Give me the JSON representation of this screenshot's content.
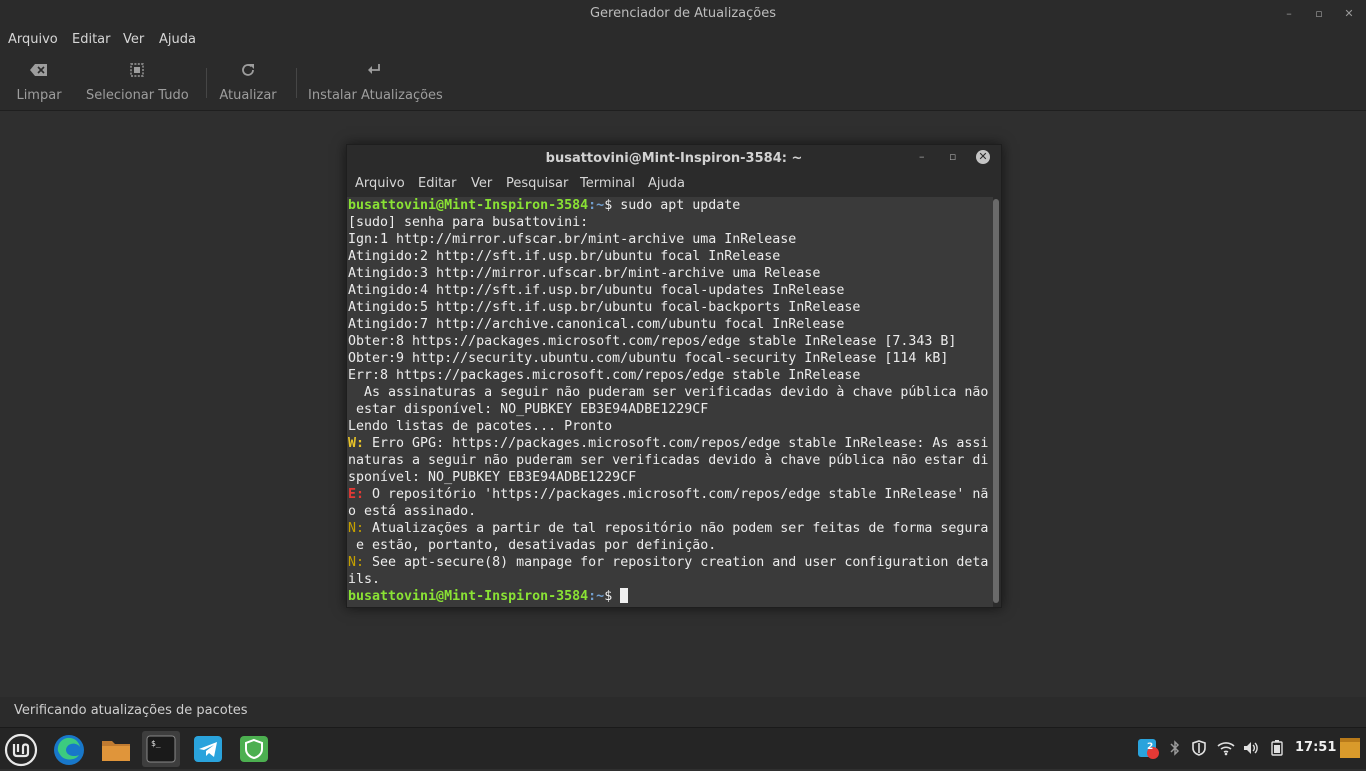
{
  "window": {
    "title": "Gerenciador de Atualizações",
    "controls": {
      "minimize": "–",
      "maximize": "▫",
      "close": "✕"
    }
  },
  "menu": [
    "Arquivo",
    "Editar",
    "Ver",
    "Ajuda"
  ],
  "toolbar": {
    "clear": "Limpar",
    "select_all": "Selecionar Tudo",
    "refresh": "Atualizar",
    "install": "Instalar Atualizações"
  },
  "status": "Verificando atualizações de pacotes",
  "terminal": {
    "title": "busattovini@Mint-Inspiron-3584: ~",
    "menu": [
      "Arquivo",
      "Editar",
      "Ver",
      "Pesquisar",
      "Terminal",
      "Ajuda"
    ],
    "prompt_user": "busattovini@Mint-Inspiron-3584",
    "prompt_path": ":~",
    "prompt_symbol": "$ ",
    "command": "sudo apt update",
    "lines": [
      "[sudo] senha para busattovini:",
      "Ign:1 http://mirror.ufscar.br/mint-archive uma InRelease",
      "Atingido:2 http://sft.if.usp.br/ubuntu focal InRelease",
      "Atingido:3 http://mirror.ufscar.br/mint-archive uma Release",
      "Atingido:4 http://sft.if.usp.br/ubuntu focal-updates InRelease",
      "Atingido:5 http://sft.if.usp.br/ubuntu focal-backports InRelease",
      "Atingido:7 http://archive.canonical.com/ubuntu focal InRelease",
      "Obter:8 https://packages.microsoft.com/repos/edge stable InRelease [7.343 B]",
      "Obter:9 http://security.ubuntu.com/ubuntu focal-security InRelease [114 kB]",
      "Err:8 https://packages.microsoft.com/repos/edge stable InRelease",
      "  As assinaturas a seguir não puderam ser verificadas devido à chave pública não",
      " estar disponível: NO_PUBKEY EB3E94ADBE1229CF",
      "Lendo listas de pacotes... Pronto"
    ],
    "warn_prefix": "W:",
    "warn_lines": [
      " Erro GPG: https://packages.microsoft.com/repos/edge stable InRelease: As assi",
      "naturas a seguir não puderam ser verificadas devido à chave pública não estar di",
      "sponível: NO_PUBKEY EB3E94ADBE1229CF"
    ],
    "err_prefix": "E:",
    "err_lines": [
      " O repositório 'https://packages.microsoft.com/repos/edge stable InRelease' nã",
      "o está assinado."
    ],
    "note_prefix": "N:",
    "note1_lines": [
      " Atualizações a partir de tal repositório não podem ser feitas de forma segura",
      " e estão, portanto, desativadas por definição."
    ],
    "note2_lines": [
      " See apt-secure(8) manpage for repository creation and user configuration deta",
      "ils."
    ]
  },
  "taskbar": {
    "apps": [
      "menu-icon",
      "edge-icon",
      "files-icon",
      "terminal-icon",
      "telegram-icon",
      "update-manager-icon"
    ],
    "notification_count": "2",
    "clock": "17:51"
  }
}
